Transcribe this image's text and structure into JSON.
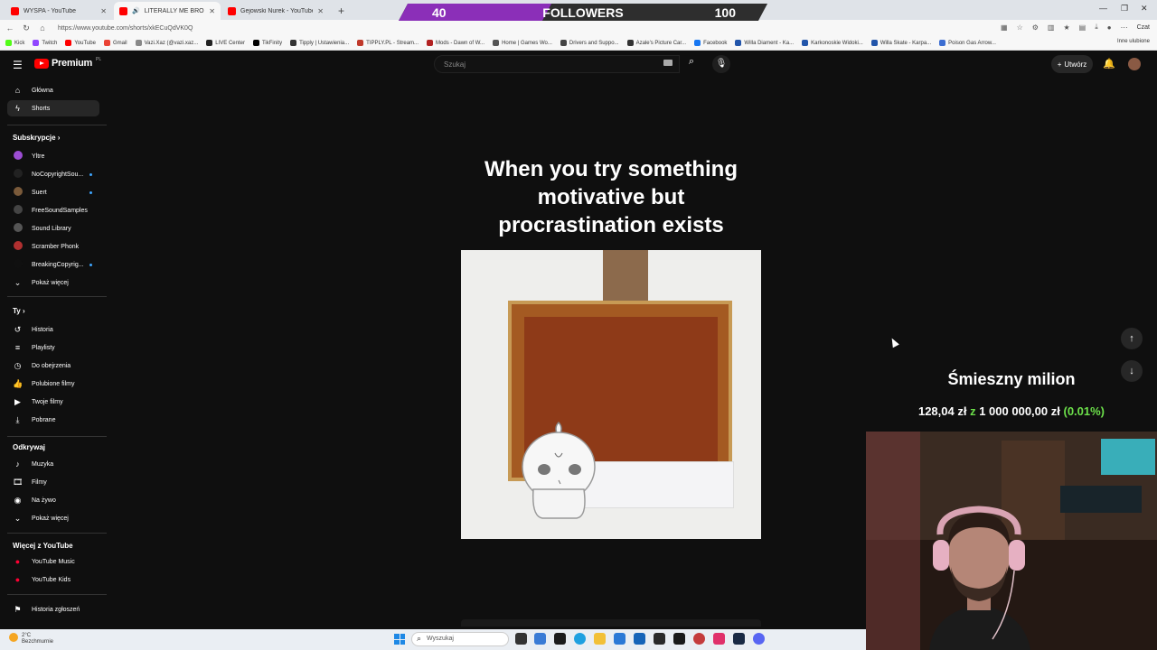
{
  "browser": {
    "tabs": [
      {
        "label": "WYSPA - YouTube",
        "active": false
      },
      {
        "label": "LITERALLY ME BRO Fart Fanfic",
        "active": true
      },
      {
        "label": "Gejowski Nurek - YouTube",
        "active": false
      }
    ],
    "new_tab": "+",
    "url": "https://www.youtube.com/shorts/xkECuQdVK0Q",
    "copilot": "Czat",
    "bookmarks": [
      "Kick",
      "Twitch",
      "YouTube",
      "Gmail",
      "Vazi.Xaz (@vazi.xaz...",
      "LIVE Center",
      "TikFinity",
      "Tipply | Ustawienia...",
      "TIPPLY.PL - Stream...",
      "Mods - Dawn of W...",
      "Home | Games Wo...",
      "Drivers and Suppo...",
      "Azale's Picture Car...",
      "Facebook",
      "Willa Diament - Ka...",
      "Karkonoskie Widoki...",
      "Willa Skate - Karpa...",
      "Poison Gas Arrow..."
    ],
    "bookmarks_more": "Inne ulubione"
  },
  "followers": {
    "start": "40",
    "label": "FOLLOWERS",
    "goal": "100",
    "progress": 0.4
  },
  "youtube": {
    "brand": "Premium",
    "country": "PL",
    "search_placeholder": "Szukaj",
    "create_label": "Utwórz"
  },
  "sidebar": {
    "main": [
      {
        "label": "Główna",
        "icon": "home-icon"
      },
      {
        "label": "Shorts",
        "icon": "shorts-icon",
        "active": true
      }
    ],
    "subscriptions_heading": "Subskrypcje",
    "subscriptions": [
      {
        "label": "Yltre",
        "color": "#9c4dd3",
        "dot": false
      },
      {
        "label": "NoCopyrightSou...",
        "color": "#222222",
        "dot": true
      },
      {
        "label": "Suert",
        "color": "#7a5a3a",
        "dot": true
      },
      {
        "label": "FreeSoundSamples",
        "color": "#444444",
        "dot": false
      },
      {
        "label": "Sound Library",
        "color": "#555555",
        "dot": false
      },
      {
        "label": "Scramber Phonk",
        "color": "#b03030",
        "dot": false
      },
      {
        "label": "BreakingCopyrig...",
        "color": "#101010",
        "dot": true
      }
    ],
    "show_more_1": "Pokaż więcej",
    "you_heading": "Ty",
    "you": [
      {
        "label": "Historia",
        "icon": "history-icon"
      },
      {
        "label": "Playlisty",
        "icon": "playlist-icon"
      },
      {
        "label": "Do obejrzenia",
        "icon": "watch-later-icon"
      },
      {
        "label": "Polubione filmy",
        "icon": "like-icon"
      },
      {
        "label": "Twoje filmy",
        "icon": "your-videos-icon"
      },
      {
        "label": "Pobrane",
        "icon": "download-icon"
      }
    ],
    "explore_heading": "Odkrywaj",
    "explore": [
      {
        "label": "Muzyka",
        "icon": "music-icon"
      },
      {
        "label": "Filmy",
        "icon": "movies-icon"
      },
      {
        "label": "Na żywo",
        "icon": "live-icon"
      }
    ],
    "show_more_2": "Pokaż więcej",
    "more_heading": "Więcej z YouTube",
    "more": [
      {
        "label": "YouTube Music",
        "color": "#ff0033"
      },
      {
        "label": "YouTube Kids",
        "color": "#ff0033"
      }
    ],
    "report_history": "Historia zgłoszeń"
  },
  "short": {
    "title_lines": [
      "When you try something",
      "motivative but",
      "procrastination exists"
    ]
  },
  "donation_goal": {
    "title": "Śmieszny milion",
    "current": "128,04 zł",
    "connector": "z",
    "target": "1 000 000,00 zł",
    "percent": "(0.01%)"
  },
  "taskbar": {
    "temperature": "2°C",
    "weather": "Bezchmurnie",
    "search_placeholder": "Wyszukaj"
  },
  "colors": {
    "followers_fill": "#8b2fb8",
    "goal_green": "#6ce04a",
    "yt_red": "#ff0000"
  }
}
